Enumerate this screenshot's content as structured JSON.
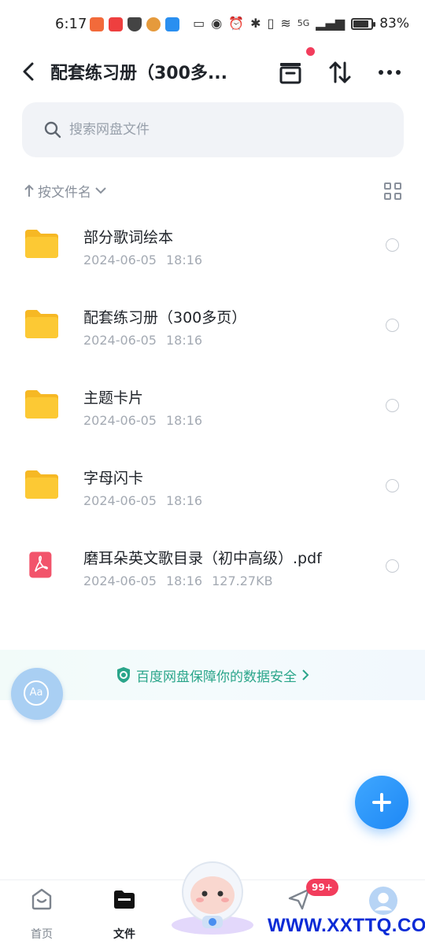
{
  "status_bar": {
    "time": "6:17",
    "battery": "83%",
    "network": "5G"
  },
  "header": {
    "title": "配套练习册（300多..."
  },
  "search": {
    "placeholder": "搜索网盘文件"
  },
  "sort": {
    "label": "按文件名"
  },
  "files": [
    {
      "name": "部分歌词绘本",
      "date": "2024-06-05",
      "time": "18:16",
      "size": "",
      "type": "folder"
    },
    {
      "name": "配套练习册（300多页）",
      "date": "2024-06-05",
      "time": "18:16",
      "size": "",
      "type": "folder"
    },
    {
      "name": "主题卡片",
      "date": "2024-06-05",
      "time": "18:16",
      "size": "",
      "type": "folder"
    },
    {
      "name": "字母闪卡",
      "date": "2024-06-05",
      "time": "18:16",
      "size": "",
      "type": "folder"
    },
    {
      "name": "磨耳朵英文歌目录（初中高级）.pdf",
      "date": "2024-06-05",
      "time": "18:16",
      "size": "127.27KB",
      "type": "pdf"
    }
  ],
  "security_banner": {
    "text": "百度网盘保障你的数据安全"
  },
  "float_tool": {
    "label": "Aa"
  },
  "bottom_nav": {
    "home": "首页",
    "files": "文件",
    "badge": "99+"
  },
  "watermark": "WWW.XXTTQ.COM",
  "colors": {
    "accent": "#1e88f5",
    "folder": "#fcc934",
    "pdf": "#f2546b",
    "security": "#2aa58a",
    "badge": "#f23d5c"
  }
}
